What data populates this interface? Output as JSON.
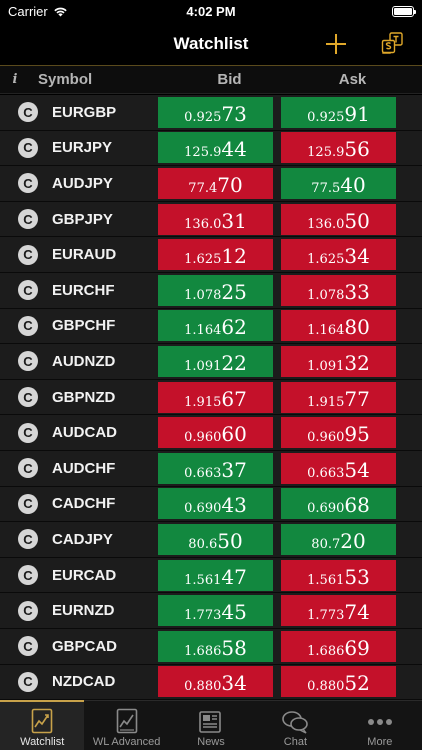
{
  "status": {
    "carrier": "Carrier",
    "time": "4:02 PM"
  },
  "nav": {
    "title": "Watchlist"
  },
  "columns": {
    "info": "i",
    "symbol": "Symbol",
    "bid": "Bid",
    "ask": "Ask"
  },
  "rows": [
    {
      "badge": "C",
      "symbol": "EURGBP",
      "bid": {
        "small": "0.925",
        "big": "73",
        "dir": "up"
      },
      "ask": {
        "small": "0.925",
        "big": "91",
        "dir": "up"
      }
    },
    {
      "badge": "C",
      "symbol": "EURJPY",
      "bid": {
        "small": "125.9",
        "big": "44",
        "dir": "up"
      },
      "ask": {
        "small": "125.9",
        "big": "56",
        "dir": "down"
      }
    },
    {
      "badge": "C",
      "symbol": "AUDJPY",
      "bid": {
        "small": "77.4",
        "big": "70",
        "dir": "down"
      },
      "ask": {
        "small": "77.5",
        "big": "40",
        "dir": "up"
      }
    },
    {
      "badge": "C",
      "symbol": "GBPJPY",
      "bid": {
        "small": "136.0",
        "big": "31",
        "dir": "down"
      },
      "ask": {
        "small": "136.0",
        "big": "50",
        "dir": "down"
      }
    },
    {
      "badge": "C",
      "symbol": "EURAUD",
      "bid": {
        "small": "1.625",
        "big": "12",
        "dir": "down"
      },
      "ask": {
        "small": "1.625",
        "big": "34",
        "dir": "down"
      }
    },
    {
      "badge": "C",
      "symbol": "EURCHF",
      "bid": {
        "small": "1.078",
        "big": "25",
        "dir": "up"
      },
      "ask": {
        "small": "1.078",
        "big": "33",
        "dir": "down"
      }
    },
    {
      "badge": "C",
      "symbol": "GBPCHF",
      "bid": {
        "small": "1.164",
        "big": "62",
        "dir": "up"
      },
      "ask": {
        "small": "1.164",
        "big": "80",
        "dir": "down"
      }
    },
    {
      "badge": "C",
      "symbol": "AUDNZD",
      "bid": {
        "small": "1.091",
        "big": "22",
        "dir": "up"
      },
      "ask": {
        "small": "1.091",
        "big": "32",
        "dir": "down"
      }
    },
    {
      "badge": "C",
      "symbol": "GBPNZD",
      "bid": {
        "small": "1.915",
        "big": "67",
        "dir": "down"
      },
      "ask": {
        "small": "1.915",
        "big": "77",
        "dir": "down"
      }
    },
    {
      "badge": "C",
      "symbol": "AUDCAD",
      "bid": {
        "small": "0.960",
        "big": "60",
        "dir": "down"
      },
      "ask": {
        "small": "0.960",
        "big": "95",
        "dir": "down"
      }
    },
    {
      "badge": "C",
      "symbol": "AUDCHF",
      "bid": {
        "small": "0.663",
        "big": "37",
        "dir": "up"
      },
      "ask": {
        "small": "0.663",
        "big": "54",
        "dir": "down"
      }
    },
    {
      "badge": "C",
      "symbol": "CADCHF",
      "bid": {
        "small": "0.690",
        "big": "43",
        "dir": "up"
      },
      "ask": {
        "small": "0.690",
        "big": "68",
        "dir": "up"
      }
    },
    {
      "badge": "C",
      "symbol": "CADJPY",
      "bid": {
        "small": "80.6",
        "big": "50",
        "dir": "up"
      },
      "ask": {
        "small": "80.7",
        "big": "20",
        "dir": "up"
      }
    },
    {
      "badge": "C",
      "symbol": "EURCAD",
      "bid": {
        "small": "1.561",
        "big": "47",
        "dir": "up"
      },
      "ask": {
        "small": "1.561",
        "big": "53",
        "dir": "down"
      }
    },
    {
      "badge": "C",
      "symbol": "EURNZD",
      "bid": {
        "small": "1.773",
        "big": "45",
        "dir": "up"
      },
      "ask": {
        "small": "1.773",
        "big": "74",
        "dir": "down"
      }
    },
    {
      "badge": "C",
      "symbol": "GBPCAD",
      "bid": {
        "small": "1.686",
        "big": "58",
        "dir": "up"
      },
      "ask": {
        "small": "1.686",
        "big": "69",
        "dir": "down"
      }
    },
    {
      "badge": "C",
      "symbol": "NZDCAD",
      "bid": {
        "small": "0.880",
        "big": "34",
        "dir": "down"
      },
      "ask": {
        "small": "0.880",
        "big": "52",
        "dir": "down"
      }
    }
  ],
  "tabs": [
    {
      "label": "Watchlist",
      "icon": "watchlist-chart-icon",
      "active": true
    },
    {
      "label": "WL Advanced",
      "icon": "advanced-chart-icon",
      "active": false
    },
    {
      "label": "News",
      "icon": "newspaper-icon",
      "active": false
    },
    {
      "label": "Chat",
      "icon": "chat-bubbles-icon",
      "active": false
    },
    {
      "label": "More",
      "icon": "more-dots-icon",
      "active": false
    }
  ],
  "colors": {
    "up": "#12883f",
    "down": "#c4112a",
    "accent": "#e0a82a"
  }
}
